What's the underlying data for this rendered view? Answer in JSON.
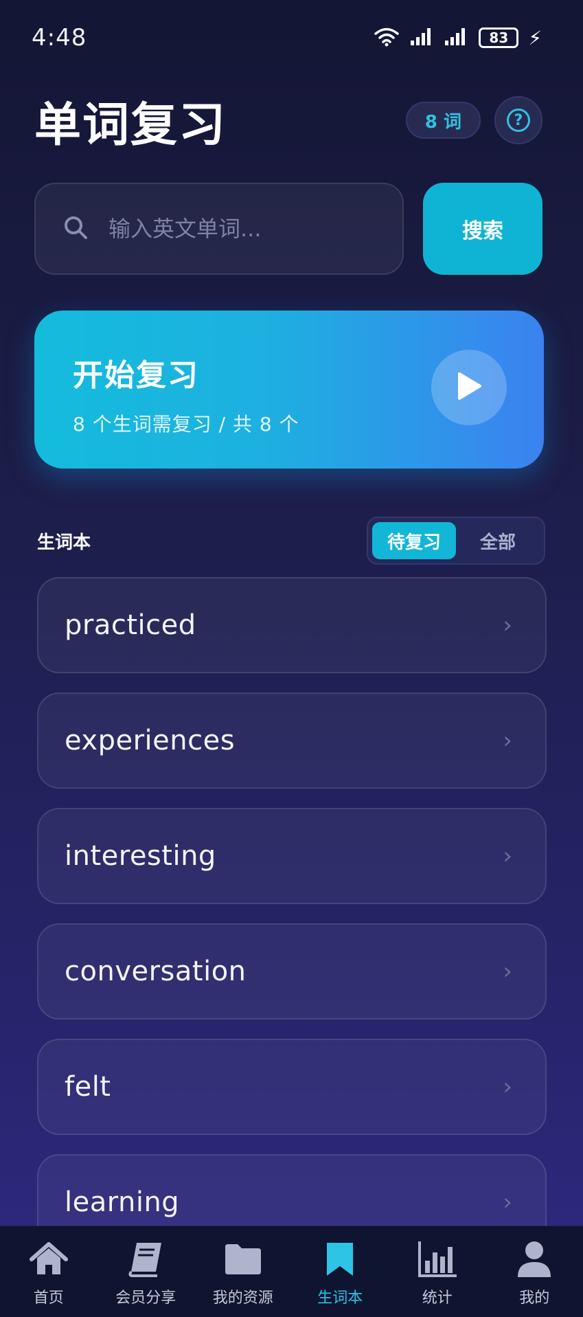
{
  "status_bar": {
    "time": "4:48",
    "battery": "83"
  },
  "header": {
    "title": "单词复习",
    "word_count_badge": "8 词",
    "help_label": "?"
  },
  "search": {
    "placeholder": "输入英文单词...",
    "button_label": "搜索"
  },
  "review_card": {
    "title": "开始复习",
    "subtitle": "8 个生词需复习 / 共 8 个"
  },
  "section": {
    "title": "生词本",
    "tabs": [
      {
        "label": "待复习",
        "active": true
      },
      {
        "label": "全部",
        "active": false
      }
    ]
  },
  "words": [
    "practiced",
    "experiences",
    "interesting",
    "conversation",
    "felt",
    "learning"
  ],
  "bottom_nav": [
    {
      "label": "首页",
      "icon": "home-icon",
      "active": false
    },
    {
      "label": "会员分享",
      "icon": "book-icon",
      "active": false
    },
    {
      "label": "我的资源",
      "icon": "folder-icon",
      "active": false
    },
    {
      "label": "生词本",
      "icon": "bookmark-icon",
      "active": true
    },
    {
      "label": "统计",
      "icon": "bar-chart-icon",
      "active": false
    },
    {
      "label": "我的",
      "icon": "user-icon",
      "active": false
    }
  ],
  "colors": {
    "accent": "#12b6d6",
    "background": "#1c1d47",
    "card_gradient_end": "#3b82f0"
  }
}
